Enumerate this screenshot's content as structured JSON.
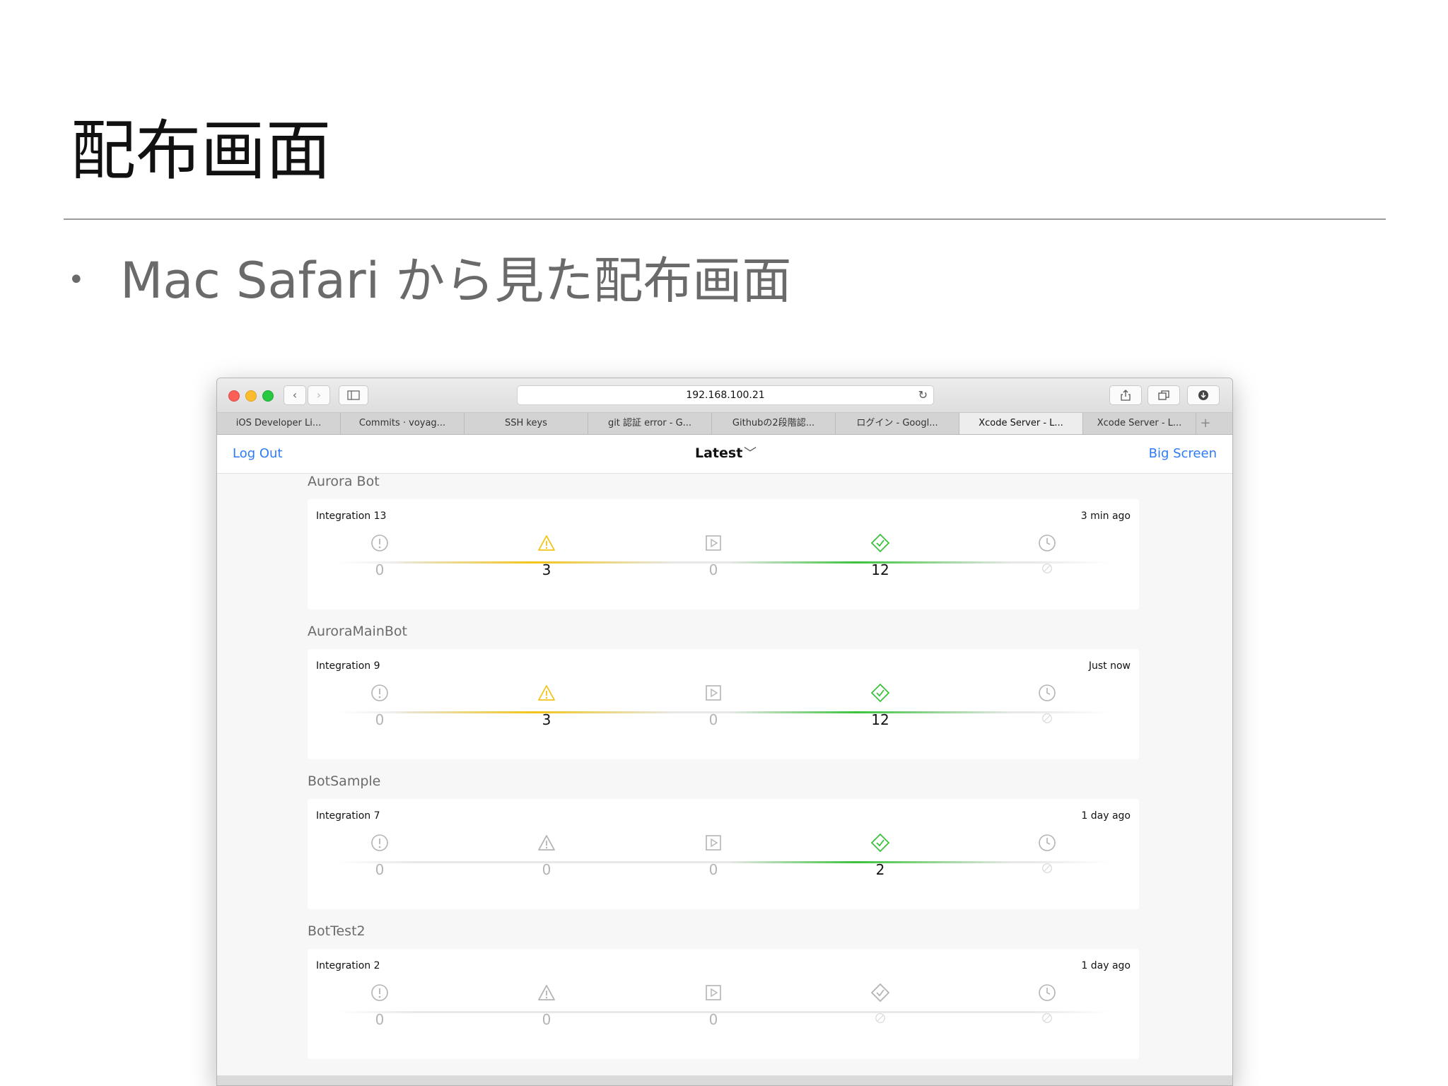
{
  "slide": {
    "title": "配布画面",
    "bullet_mark": "•",
    "bullet": "Mac Safari から見た配布画面"
  },
  "browser": {
    "url": "192.168.100.21",
    "tabs": [
      {
        "label": "iOS Developer Li...",
        "active": false
      },
      {
        "label": "Commits · voyag...",
        "active": false
      },
      {
        "label": "SSH keys",
        "active": false
      },
      {
        "label": "git 認証 error - G...",
        "active": false
      },
      {
        "label": "Githubの2段階認...",
        "active": false
      },
      {
        "label": "ログイン - Googl...",
        "active": false
      },
      {
        "label": "Xcode Server - L...",
        "active": true
      },
      {
        "label": "Xcode Server - L...",
        "active": false
      }
    ],
    "new_tab": "+"
  },
  "app": {
    "logout": "Log Out",
    "filter": "Latest",
    "big_screen": "Big Screen"
  },
  "bots": [
    {
      "name": "Aurora Bot",
      "integration": "Integration 13",
      "time": "3 min ago",
      "errors": "0",
      "warnings": "3",
      "analysis": "0",
      "tests": "12",
      "coverage": "",
      "warning_active": true,
      "test_active": true
    },
    {
      "name": "AuroraMainBot",
      "integration": "Integration 9",
      "time": "Just now",
      "errors": "0",
      "warnings": "3",
      "analysis": "0",
      "tests": "12",
      "coverage": "",
      "warning_active": true,
      "test_active": true
    },
    {
      "name": "BotSample",
      "integration": "Integration 7",
      "time": "1 day ago",
      "errors": "0",
      "warnings": "0",
      "analysis": "0",
      "tests": "2",
      "coverage": "",
      "warning_active": false,
      "test_active": true
    },
    {
      "name": "BotTest2",
      "integration": "Integration 2",
      "time": "1 day ago",
      "errors": "0",
      "warnings": "0",
      "analysis": "0",
      "tests": "",
      "coverage": "",
      "warning_active": false,
      "test_active": false
    }
  ],
  "colors": {
    "link": "#2d7cf6",
    "warning": "#f2c417",
    "success": "#3cc23c",
    "muted": "#b4b4b4"
  }
}
